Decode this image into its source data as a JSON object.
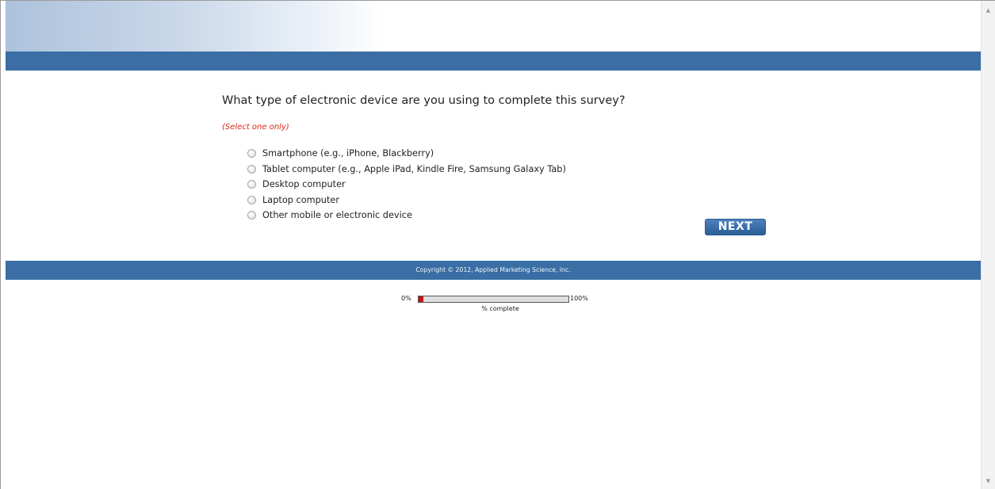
{
  "question": {
    "text": "What type of electronic device are you using to complete this survey?",
    "instruction": "(Select one only)"
  },
  "options": [
    {
      "label": "Smartphone (e.g., iPhone, Blackberry)",
      "selected": false
    },
    {
      "label": "Tablet computer (e.g., Apple iPad, Kindle Fire, Samsung Galaxy Tab)",
      "selected": false
    },
    {
      "label": "Desktop computer",
      "selected": false
    },
    {
      "label": "Laptop computer",
      "selected": false
    },
    {
      "label": "Other mobile or electronic device",
      "selected": false
    }
  ],
  "next_label": "NEXT",
  "footer": {
    "copyright": "Copyright © 2012, Applied Marketing Science, Inc."
  },
  "progress": {
    "min_label": "0%",
    "max_label": "100%",
    "caption": "% complete",
    "percent": 3
  },
  "colors": {
    "brand_bar": "#3a6ea5",
    "instruction": "#e0261b",
    "progress_fill": "#c41616"
  },
  "icons": {
    "scroll_up": "triangle-up",
    "scroll_down": "triangle-down"
  }
}
